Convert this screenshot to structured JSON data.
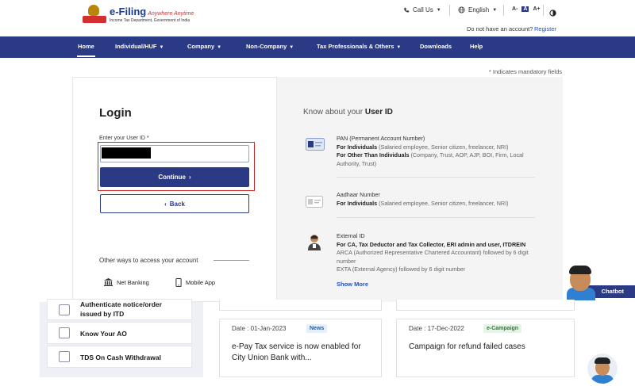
{
  "header": {
    "brand": "e-Filing",
    "brand_tag": "Anywhere Anytime",
    "brand_sub": "Income Tax Department, Government of India",
    "call_us": "Call Us",
    "language": "English",
    "font_small": "A-",
    "font_normal": "A",
    "font_large": "A+",
    "account_prompt": "Do not have an account?",
    "register": "Register"
  },
  "nav": {
    "items": [
      {
        "label": "Home"
      },
      {
        "label": "Individual/HUF"
      },
      {
        "label": "Company"
      },
      {
        "label": "Non-Company"
      },
      {
        "label": "Tax Professionals & Others"
      },
      {
        "label": "Downloads"
      },
      {
        "label": "Help"
      }
    ]
  },
  "mandatory_note": "* Indicates mandatory fields",
  "login": {
    "title": "Login",
    "userid_label": "Enter your User ID *",
    "userid_value": "",
    "continue": "Continue",
    "back": "Back",
    "other_ways": "Other ways to access your account",
    "net_banking": "Net Banking",
    "mobile_app": "Mobile App"
  },
  "info": {
    "title_prefix": "Know about your",
    "title_bold": "User ID",
    "pan": {
      "name": "PAN (Permanent Account Number)",
      "ind_label": "For Individuals",
      "ind_text": "(Salaried employee, Senior citizen, freelancer, NRI)",
      "other_label": "For Other Than Individuals",
      "other_text": "(Company, Trust, AOP, AJP, BOI, Firm, Local Authority, Trust)"
    },
    "aadhaar": {
      "name": "Aadhaar Number",
      "ind_label": "For Individuals",
      "ind_text": "(Salaried employee, Senior citizen, freelancer, NRI)"
    },
    "external": {
      "name": "External ID",
      "bold_line": "For CA, Tax Deductor and Tax Collector, ERI admin and user, ITDREIN",
      "arca": "ARCA (Authorized Representative Chartered Accountant) followed by 6 digit number",
      "exta": "EXTA (External Agency) followed by 6 digit number"
    },
    "show_more": "Show More"
  },
  "lower_left": {
    "items": [
      {
        "label": "Authenticate notice/order issued by ITD"
      },
      {
        "label": "Know Your AO"
      },
      {
        "label": "TDS On Cash Withdrawal"
      }
    ]
  },
  "news": [
    {
      "date": "Date : 01-Jan-2023",
      "badge": "News",
      "title": "e-Pay Tax service is now enabled for City Union Bank with..."
    },
    {
      "date": "Date : 17-Dec-2022",
      "badge": "e-Campaign",
      "title": "Campaign for refund failed cases"
    }
  ],
  "chatbot": {
    "label": "Chatbot"
  },
  "colors": {
    "navy": "#2a3a85",
    "link": "#1e4fd8",
    "highlight": "#c62828"
  }
}
